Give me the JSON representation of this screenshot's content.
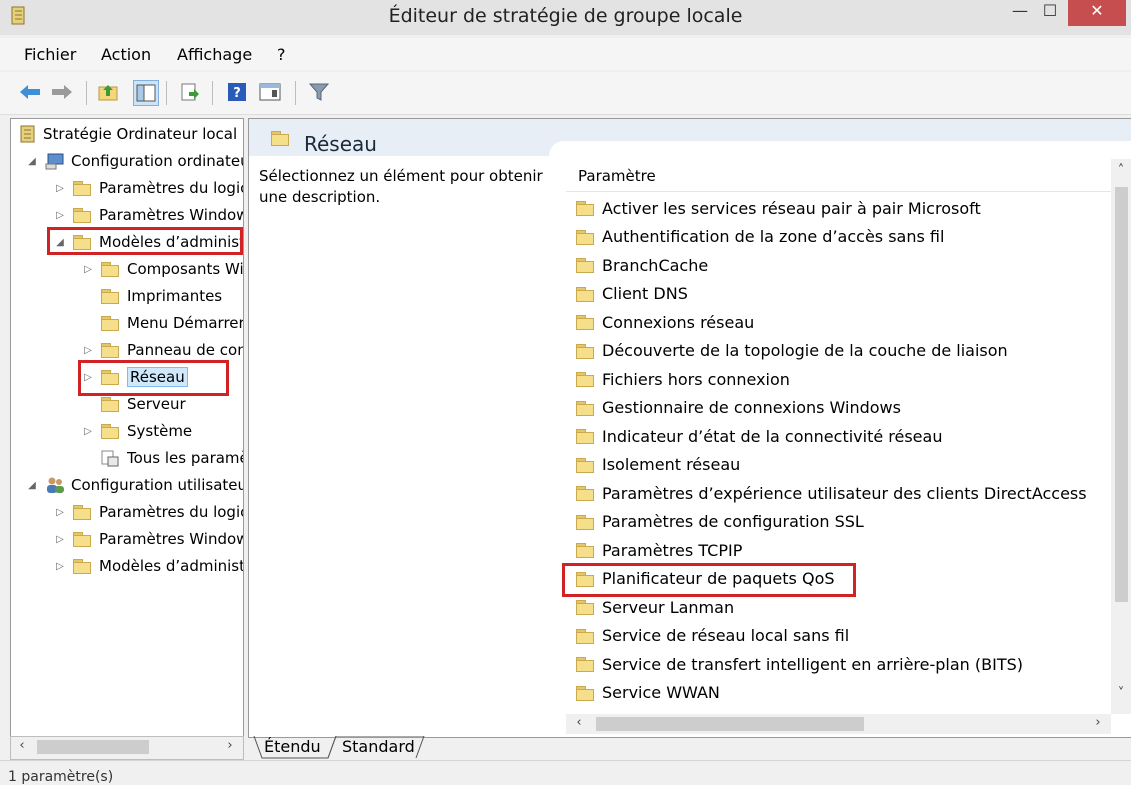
{
  "window": {
    "title": "Éditeur de stratégie de groupe locale",
    "minimize": "—",
    "maximize": "☐",
    "close": "✕"
  },
  "menu": [
    "Fichier",
    "Action",
    "Affichage",
    "?"
  ],
  "toolbar_icons": [
    "back-icon",
    "forward-icon",
    "up-folder-icon",
    "show-hide-tree-icon",
    "export-list-icon",
    "help-icon",
    "properties-icon",
    "filter-icon"
  ],
  "tree": {
    "items": [
      {
        "label": "Stratégie Ordinateur local"
      },
      {
        "label": "Configuration ordinateur"
      },
      {
        "label": "Paramètres du logiciel"
      },
      {
        "label": "Paramètres Windows"
      },
      {
        "label": "Modèles d’administration"
      },
      {
        "label": "Composants Windows"
      },
      {
        "label": "Imprimantes"
      },
      {
        "label": "Menu Démarrer"
      },
      {
        "label": "Panneau de configuration"
      },
      {
        "label": "Réseau"
      },
      {
        "label": "Serveur"
      },
      {
        "label": "Système"
      },
      {
        "label": "Tous les paramètres"
      },
      {
        "label": "Configuration utilisateur"
      },
      {
        "label": "Paramètres du logiciel"
      },
      {
        "label": "Paramètres Windows"
      },
      {
        "label": "Modèles d’administration"
      }
    ],
    "selected": "Réseau"
  },
  "main": {
    "header_title": "Réseau",
    "description": "Sélectionnez un élément pour obtenir une description.",
    "column_header": "Paramètre",
    "rows": [
      "Activer les services réseau pair à pair Microsoft",
      "Authentification de la zone d’accès sans fil",
      "BranchCache",
      "Client DNS",
      "Connexions réseau",
      "Découverte de la topologie de la couche de liaison",
      "Fichiers hors connexion",
      "Gestionnaire de connexions Windows",
      "Indicateur d’état de la connectivité réseau",
      "Isolement réseau",
      "Paramètres d’expérience utilisateur des clients DirectAccess",
      "Paramètres de configuration SSL",
      "Paramètres TCPIP",
      "Planificateur de paquets QoS",
      "Serveur Lanman",
      "Service de réseau local sans fil",
      "Service de transfert intelligent en arrière-plan (BITS)",
      "Service WWAN"
    ],
    "highlighted_row": "Planificateur de paquets QoS"
  },
  "tabs": [
    "Étendu",
    "Standard"
  ],
  "status": "1 paramètre(s)",
  "colors": {
    "highlight_box": "#d12226",
    "selection": "#cfe8fc",
    "header_band": "#e8eef5",
    "close_button": "#c74e4e"
  }
}
